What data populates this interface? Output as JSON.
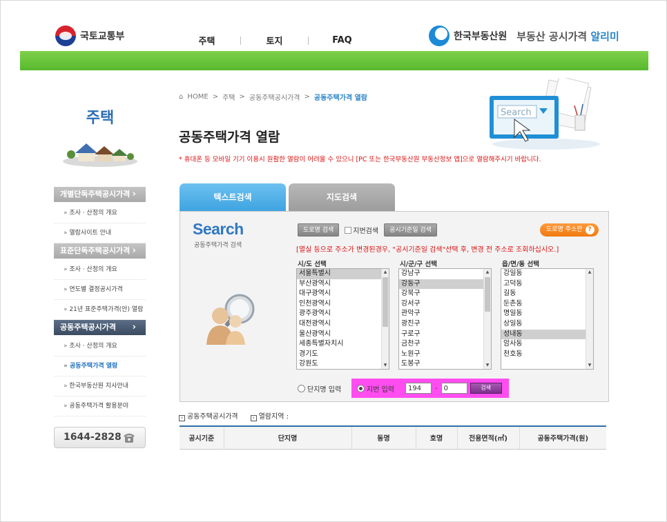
{
  "header": {
    "ministry": "국토교통부",
    "nav": [
      "주택",
      "토지",
      "FAQ"
    ],
    "org": "한국부동산원",
    "service": "부동산 공시가격",
    "service_highlight": "알리미"
  },
  "sidebar": {
    "title": "주택",
    "menu": [
      {
        "type": "category",
        "label": "개별단독주택공시가격",
        "active": false
      },
      {
        "type": "item",
        "label": "조사 · 산정의 개요"
      },
      {
        "type": "item",
        "label": "열람사이트 안내"
      },
      {
        "type": "category",
        "label": "표준단독주택공시가격",
        "active": false
      },
      {
        "type": "item",
        "label": "조사 · 산정의 개요"
      },
      {
        "type": "item",
        "label": "연도별 결정공시가격"
      },
      {
        "type": "item",
        "label": "21년 표준주택가격(안) 열람"
      },
      {
        "type": "category",
        "label": "공동주택공시가격",
        "active": true
      },
      {
        "type": "item",
        "label": "조사 · 산정의 개요"
      },
      {
        "type": "item",
        "label": "공동주택가격 열람",
        "current": true
      },
      {
        "type": "item",
        "label": "한국부동산원 지사안내"
      },
      {
        "type": "item",
        "label": "공동주택가격 활용분야"
      }
    ],
    "phone": "1644-2828"
  },
  "breadcrumb": [
    "HOME",
    "주택",
    "공동주택공시가격",
    "공동주택가격 열람"
  ],
  "page_title": "공동주택가격 열람",
  "notice": "* 휴대폰 등 모바일 기기 이용시 원활한 열람이 어려울 수 있으니 [PC 또는 한국부동산원 부동산정보 앱]으로 열람해주시기 바랍니다.",
  "tabs": [
    {
      "label": "텍스트검색",
      "active": true
    },
    {
      "label": "지도검색",
      "active": false
    }
  ],
  "search": {
    "logo": "Search",
    "logo_sub": "공동주택가격 검색",
    "mode_buttons": {
      "road": "도로명 검색",
      "jibeon_img_alt": "지번검색",
      "date": "공시기준일 검색"
    },
    "road_helper": "도로명 주소란",
    "warning": "[멸실 등으로 주소가 변경된경우, \"공시기준일 검색\"선택 후, 변경 전 주소로 조회하십시오.]",
    "sido_label": "시/도 선택",
    "sigungu_label": "시/군/구 선택",
    "eupmyeondong_label": "읍/면/동 선택",
    "sido_options": [
      "서울특별시",
      "부산광역시",
      "대구광역시",
      "인천광역시",
      "광주광역시",
      "대전광역시",
      "울산광역시",
      "세종특별자치시",
      "경기도",
      "강원도"
    ],
    "sigungu_options": [
      "강남구",
      "강동구",
      "강북구",
      "강서구",
      "관악구",
      "광진구",
      "구로구",
      "금천구",
      "노원구",
      "도봉구"
    ],
    "dong_options": [
      "강일동",
      "고덕동",
      "길동",
      "둔촌동",
      "명일동",
      "상일동",
      "성내동",
      "암사동",
      "천호동"
    ],
    "radio_danji": "단지명 입력",
    "radio_jibeon": "지번 입력",
    "main_no": "194",
    "sub_no": "0",
    "dash": "-",
    "search_button": "검색"
  },
  "info": {
    "label1": "공동주택공시가격",
    "label2": "열람지역 :"
  },
  "table": {
    "headers": [
      "공시기준",
      "단지명",
      "동명",
      "호명",
      "전용면적(㎡)",
      "공동주택가격(원)"
    ]
  }
}
